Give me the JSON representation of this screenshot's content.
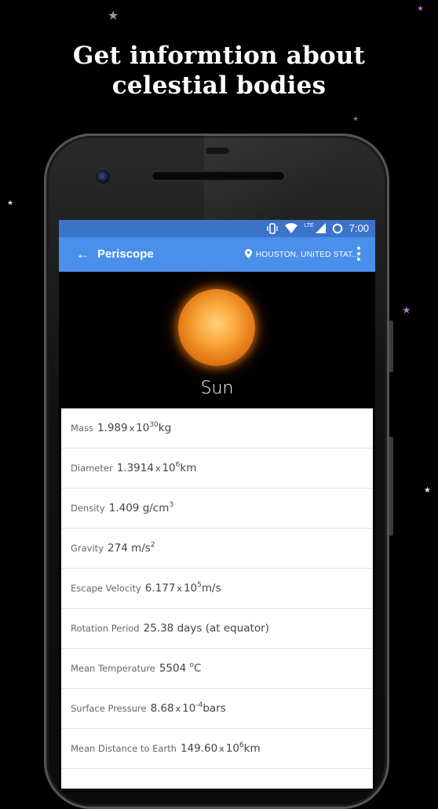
{
  "headline": {
    "line1": "Get informtion about",
    "line2": "celestial bodies"
  },
  "status_bar": {
    "network": "LTE",
    "time": "7:00"
  },
  "app_bar": {
    "back": "←",
    "title": "Periscope",
    "location": "HOUSTON, UNITED STAT..."
  },
  "body": {
    "name": "Sun"
  },
  "properties": {
    "mass": {
      "label": "Mass",
      "value": "1.989",
      "times": "x",
      "base": "10",
      "exp": "30",
      "unit": "kg"
    },
    "diameter": {
      "label": "Diameter",
      "value": "1.3914",
      "times": "x",
      "base": "10",
      "exp": "6",
      "unit": "km"
    },
    "density": {
      "label": "Density",
      "value": "1.409",
      "unit": "g/cm",
      "exp": "3"
    },
    "gravity": {
      "label": "Gravity",
      "value": "274",
      "unit": "m/s",
      "exp": "2"
    },
    "escape_velocity": {
      "label": "Escape Velocity",
      "value": "6.177",
      "times": "x",
      "base": "10",
      "exp": "5",
      "unit": "m/s"
    },
    "rotation_period": {
      "label": "Rotation Period",
      "value": "25.38",
      "unit": "days (at equator)"
    },
    "mean_temperature": {
      "label": "Mean Temperature",
      "value": "5504",
      "exp": "o",
      "unit": "C"
    },
    "surface_pressure": {
      "label": "Surface Pressure",
      "value": "8.68",
      "times": "x",
      "base": "10",
      "exp": "-4",
      "unit": "bars"
    },
    "mean_distance": {
      "label": "Mean Distance to Earth",
      "value": "149.60",
      "times": "x",
      "base": "10",
      "exp": "6",
      "unit": "km"
    }
  },
  "colors": {
    "status_bar": "#3b73c9",
    "app_bar": "#4a8fea",
    "background": "#000000",
    "card": "#ffffff"
  }
}
